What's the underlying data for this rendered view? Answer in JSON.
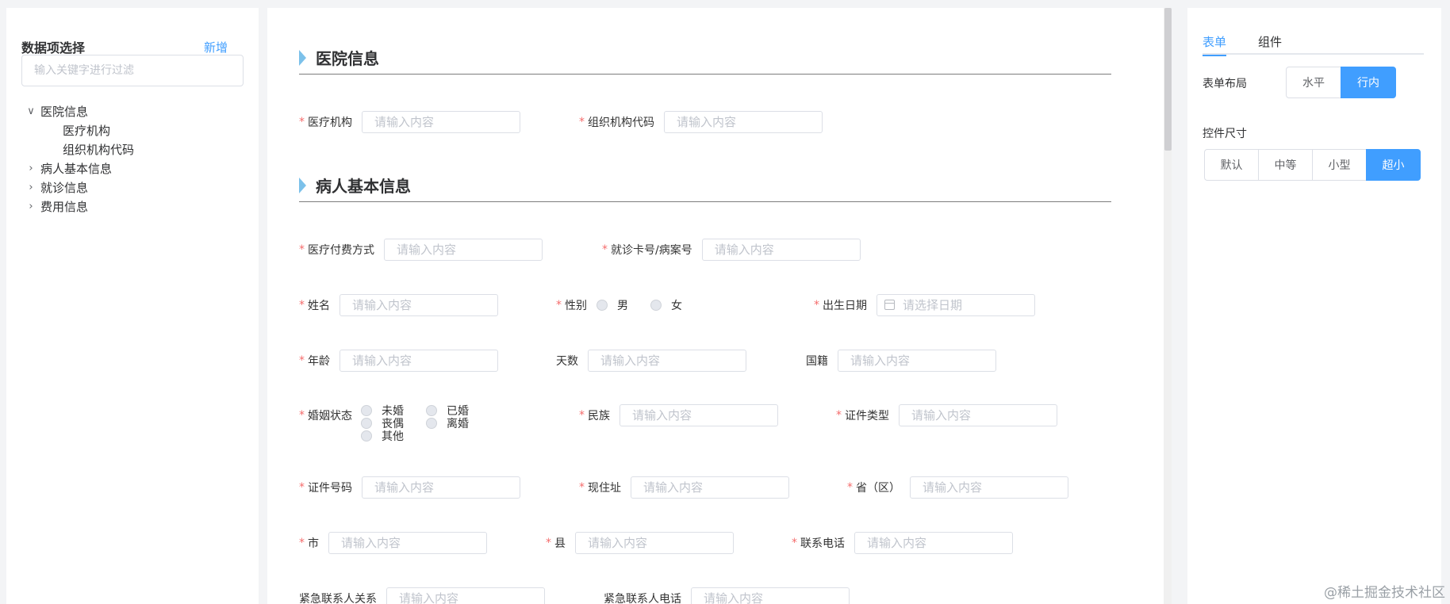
{
  "left_panel": {
    "title": "数据项选择",
    "add_label": "新增",
    "filter_placeholder": "输入关键字进行过滤",
    "tree": {
      "hospital": "医院信息",
      "hospital_children": [
        "医疗机构",
        "组织机构代码"
      ],
      "patient_basic": "病人基本信息",
      "visit": "就诊信息",
      "fee": "费用信息"
    }
  },
  "form": {
    "section_hospital": "医院信息",
    "section_patient": "病人基本信息",
    "input_placeholder": "请输入内容",
    "date_placeholder": "请选择日期",
    "labels": {
      "medical_institution": "医疗机构",
      "org_code": "组织机构代码",
      "payment_method": "医疗付费方式",
      "card_number": "就诊卡号/病案号",
      "name": "姓名",
      "gender": "性别",
      "birth_date": "出生日期",
      "age": "年龄",
      "days": "天数",
      "nationality": "国籍",
      "marital_status": "婚姻状态",
      "ethnicity": "民族",
      "id_type": "证件类型",
      "id_number": "证件号码",
      "current_address": "现住址",
      "province": "省（区）",
      "city": "市",
      "county": "县",
      "phone": "联系电话",
      "emergency_relation": "紧急联系人关系",
      "emergency_phone": "紧急联系人电话"
    },
    "gender_options": [
      "男",
      "女"
    ],
    "marital_options": [
      "未婚",
      "已婚",
      "丧偶",
      "离婚",
      "其他"
    ]
  },
  "right_panel": {
    "tabs": [
      "表单",
      "组件"
    ],
    "form_layout_label": "表单布局",
    "layout_options": [
      "水平",
      "行内"
    ],
    "control_size_label": "控件尺寸",
    "size_options": [
      "默认",
      "中等",
      "小型",
      "超小"
    ]
  },
  "watermark": "@稀土掘金技术社区",
  "colors": {
    "primary": "#409eff",
    "required": "#f56c6c",
    "section_marker": "#7cc1ea",
    "page_bg": "#f3f4f6"
  }
}
